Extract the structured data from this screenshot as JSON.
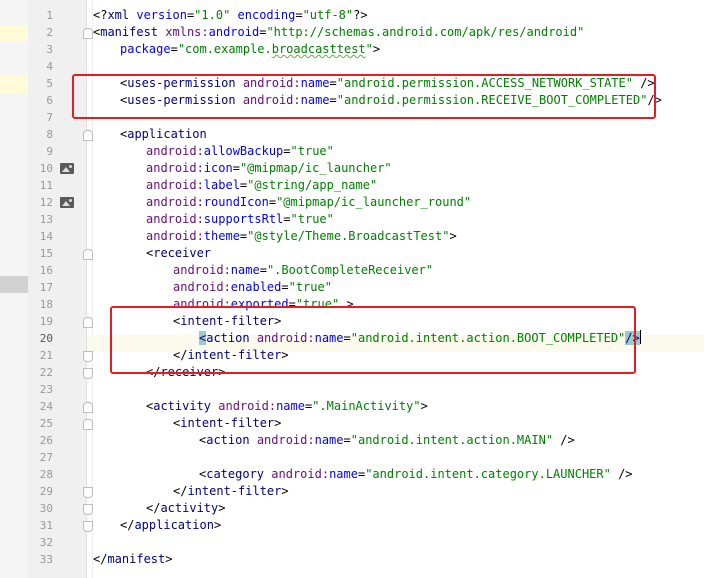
{
  "editor": {
    "lines": [
      {
        "num": "1",
        "indent": 0,
        "parts": [
          [
            "txt",
            "<?"
          ],
          [
            "tag",
            "xml "
          ],
          [
            "attr",
            "version"
          ],
          [
            "txt",
            "="
          ],
          [
            "val",
            "\"1.0\""
          ],
          [
            "txt",
            " "
          ],
          [
            "attr",
            "encoding"
          ],
          [
            "txt",
            "="
          ],
          [
            "val",
            "\"utf-8\""
          ],
          [
            "txt",
            "?>"
          ]
        ]
      },
      {
        "num": "2",
        "indent": 0,
        "parts": [
          [
            "txt",
            "<"
          ],
          [
            "tag",
            "manifest "
          ],
          [
            "ns",
            "xmlns:"
          ],
          [
            "attr",
            "android"
          ],
          [
            "txt",
            "="
          ],
          [
            "val",
            "\"http://schemas.android.com/apk/res/android\""
          ]
        ]
      },
      {
        "num": "3",
        "indent": 4,
        "parts": [
          [
            "attr",
            "package"
          ],
          [
            "txt",
            "="
          ],
          [
            "val",
            "\"com.example."
          ],
          [
            "valsq",
            "broadcasttest"
          ],
          [
            "val",
            "\""
          ],
          [
            "txt",
            ">"
          ]
        ]
      },
      {
        "num": "4",
        "indent": 0,
        "parts": []
      },
      {
        "num": "5",
        "indent": 4,
        "parts": [
          [
            "txt",
            "<"
          ],
          [
            "tag",
            "uses-permission "
          ],
          [
            "ns",
            "android:"
          ],
          [
            "attr",
            "name"
          ],
          [
            "txt",
            "="
          ],
          [
            "val",
            "\"android.permission.ACCESS_NETWORK_STATE\""
          ],
          [
            "txt",
            " />"
          ]
        ]
      },
      {
        "num": "6",
        "indent": 4,
        "parts": [
          [
            "txt",
            "<"
          ],
          [
            "tag",
            "uses-permission "
          ],
          [
            "ns",
            "android:"
          ],
          [
            "attr",
            "name"
          ],
          [
            "txt",
            "="
          ],
          [
            "val",
            "\"android.permission.RECEIVE_BOOT_COMPLETED\""
          ],
          [
            "txt",
            "/>"
          ]
        ]
      },
      {
        "num": "7",
        "indent": 0,
        "parts": []
      },
      {
        "num": "8",
        "indent": 4,
        "parts": [
          [
            "txt",
            "<"
          ],
          [
            "tag",
            "application"
          ]
        ]
      },
      {
        "num": "9",
        "indent": 8,
        "parts": [
          [
            "ns",
            "android:"
          ],
          [
            "attr",
            "allowBackup"
          ],
          [
            "txt",
            "="
          ],
          [
            "val",
            "\"true\""
          ]
        ]
      },
      {
        "num": "10",
        "indent": 8,
        "parts": [
          [
            "ns",
            "android:"
          ],
          [
            "attr",
            "icon"
          ],
          [
            "txt",
            "="
          ],
          [
            "val",
            "\"@mipmap/ic_launcher\""
          ]
        ]
      },
      {
        "num": "11",
        "indent": 8,
        "parts": [
          [
            "ns",
            "android:"
          ],
          [
            "attr",
            "label"
          ],
          [
            "txt",
            "="
          ],
          [
            "val",
            "\"@string/app_name\""
          ]
        ]
      },
      {
        "num": "12",
        "indent": 8,
        "parts": [
          [
            "ns",
            "android:"
          ],
          [
            "attr",
            "roundIcon"
          ],
          [
            "txt",
            "="
          ],
          [
            "val",
            "\"@mipmap/ic_launcher_round\""
          ]
        ]
      },
      {
        "num": "13",
        "indent": 8,
        "parts": [
          [
            "ns",
            "android:"
          ],
          [
            "attr",
            "supportsRtl"
          ],
          [
            "txt",
            "="
          ],
          [
            "val",
            "\"true\""
          ]
        ]
      },
      {
        "num": "14",
        "indent": 8,
        "parts": [
          [
            "ns",
            "android:"
          ],
          [
            "attr",
            "theme"
          ],
          [
            "txt",
            "="
          ],
          [
            "val",
            "\"@style/Theme.BroadcastTest\""
          ],
          [
            "txt",
            ">"
          ]
        ]
      },
      {
        "num": "15",
        "indent": 8,
        "parts": [
          [
            "txt",
            "<"
          ],
          [
            "tag",
            "receiver"
          ]
        ]
      },
      {
        "num": "16",
        "indent": 12,
        "parts": [
          [
            "ns",
            "android:"
          ],
          [
            "attr",
            "name"
          ],
          [
            "txt",
            "="
          ],
          [
            "val",
            "\".BootCompleteReceiver\""
          ]
        ]
      },
      {
        "num": "17",
        "indent": 12,
        "parts": [
          [
            "ns",
            "android:"
          ],
          [
            "attr",
            "enabled"
          ],
          [
            "txt",
            "="
          ],
          [
            "val",
            "\"true\""
          ]
        ]
      },
      {
        "num": "18",
        "indent": 12,
        "parts": [
          [
            "ns",
            "android:"
          ],
          [
            "attr",
            "exported"
          ],
          [
            "txt",
            "="
          ],
          [
            "val",
            "\"true\""
          ],
          [
            "txt",
            " >"
          ]
        ]
      },
      {
        "num": "19",
        "indent": 12,
        "parts": [
          [
            "txt",
            "<"
          ],
          [
            "tag",
            "intent-filter"
          ],
          [
            "txt",
            ">"
          ]
        ]
      },
      {
        "num": "20",
        "indent": 16,
        "parts": [
          [
            "match",
            "<"
          ],
          [
            "tag",
            "action "
          ],
          [
            "ns",
            "android:"
          ],
          [
            "attr",
            "name"
          ],
          [
            "txt",
            "="
          ],
          [
            "val",
            "\"android.intent.action.BOOT_COMPLETED\""
          ],
          [
            "match",
            "/>"
          ],
          [
            "caret",
            ""
          ]
        ]
      },
      {
        "num": "21",
        "indent": 12,
        "parts": [
          [
            "txt",
            "</"
          ],
          [
            "tag",
            "intent-filter"
          ],
          [
            "txt",
            ">"
          ]
        ]
      },
      {
        "num": "22",
        "indent": 8,
        "parts": [
          [
            "txt",
            "</"
          ],
          [
            "tag",
            "receiver"
          ],
          [
            "txt",
            ">"
          ]
        ]
      },
      {
        "num": "23",
        "indent": 0,
        "parts": []
      },
      {
        "num": "24",
        "indent": 8,
        "parts": [
          [
            "txt",
            "<"
          ],
          [
            "tag",
            "activity "
          ],
          [
            "ns",
            "android:"
          ],
          [
            "attr",
            "name"
          ],
          [
            "txt",
            "="
          ],
          [
            "val",
            "\".MainActivity\""
          ],
          [
            "txt",
            ">"
          ]
        ]
      },
      {
        "num": "25",
        "indent": 12,
        "parts": [
          [
            "txt",
            "<"
          ],
          [
            "tag",
            "intent-filter"
          ],
          [
            "txt",
            ">"
          ]
        ]
      },
      {
        "num": "26",
        "indent": 16,
        "parts": [
          [
            "txt",
            "<"
          ],
          [
            "tag",
            "action "
          ],
          [
            "ns",
            "android:"
          ],
          [
            "attr",
            "name"
          ],
          [
            "txt",
            "="
          ],
          [
            "val",
            "\"android.intent.action.MAIN\""
          ],
          [
            "txt",
            " />"
          ]
        ]
      },
      {
        "num": "27",
        "indent": 0,
        "parts": []
      },
      {
        "num": "28",
        "indent": 16,
        "parts": [
          [
            "txt",
            "<"
          ],
          [
            "tag",
            "category "
          ],
          [
            "ns",
            "android:"
          ],
          [
            "attr",
            "name"
          ],
          [
            "txt",
            "="
          ],
          [
            "val",
            "\"android.intent.category.LAUNCHER\""
          ],
          [
            "txt",
            " />"
          ]
        ]
      },
      {
        "num": "29",
        "indent": 12,
        "parts": [
          [
            "txt",
            "</"
          ],
          [
            "tag",
            "intent-filter"
          ],
          [
            "txt",
            ">"
          ]
        ]
      },
      {
        "num": "30",
        "indent": 8,
        "parts": [
          [
            "txt",
            "</"
          ],
          [
            "tag",
            "activity"
          ],
          [
            "txt",
            ">"
          ]
        ]
      },
      {
        "num": "31",
        "indent": 4,
        "parts": [
          [
            "txt",
            "</"
          ],
          [
            "tag",
            "application"
          ],
          [
            "txt",
            ">"
          ]
        ]
      },
      {
        "num": "32",
        "indent": 0,
        "parts": []
      },
      {
        "num": "33",
        "indent": 0,
        "parts": [
          [
            "txt",
            "</"
          ],
          [
            "tag",
            "manifest"
          ],
          [
            "txt",
            ">"
          ]
        ]
      }
    ],
    "gutter_image_icons": [
      "10",
      "12"
    ],
    "current_line": "20",
    "highlight_color": "#e02020"
  }
}
